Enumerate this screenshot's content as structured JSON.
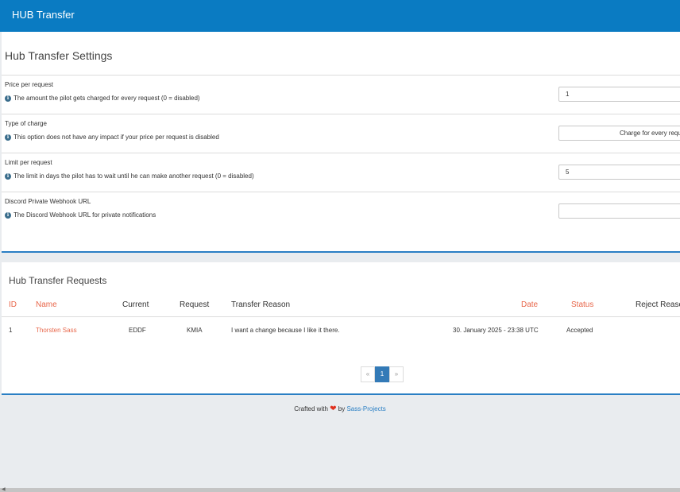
{
  "header": {
    "title": "HUB Transfer"
  },
  "settings": {
    "title": "Hub Transfer Settings",
    "rows": [
      {
        "label": "Price per request",
        "help": "The amount the pilot gets charged for every request (0 = disabled)",
        "value": "1"
      },
      {
        "label": "Type of charge",
        "help": "This option does not have any impact if your price per request is disabled",
        "value": "Charge for every request"
      },
      {
        "label": "Limit per request",
        "help": "The limit in days the pilot has to wait until he can make another request (0 = disabled)",
        "value": "5"
      },
      {
        "label": "Discord Private Webhook URL",
        "help": "The Discord Webhook URL for private notifications",
        "value": ""
      }
    ]
  },
  "requests": {
    "title": "Hub Transfer Requests",
    "columns": {
      "id": "ID",
      "name": "Name",
      "current": "Current",
      "request": "Request",
      "reason": "Transfer Reason",
      "date": "Date",
      "status": "Status",
      "reject": "Reject Reason"
    },
    "rows": [
      {
        "id": "1",
        "name": "Thorsten Sass",
        "current": "EDDF",
        "request": "KMIA",
        "reason": "I want a change because I like it there.",
        "date": "30. January 2025 - 23:38 UTC",
        "status": "Accepted"
      }
    ],
    "pagination": {
      "prev": "«",
      "current": "1",
      "next": "»"
    }
  },
  "footer": {
    "prefix": "Crafted with",
    "heart": "❤",
    "by": "by",
    "brand": "Sass-Projects"
  },
  "colors": {
    "header": "#0a7bc2",
    "accent_link": "#e8674b",
    "panel_border": "#2a7fc4"
  }
}
